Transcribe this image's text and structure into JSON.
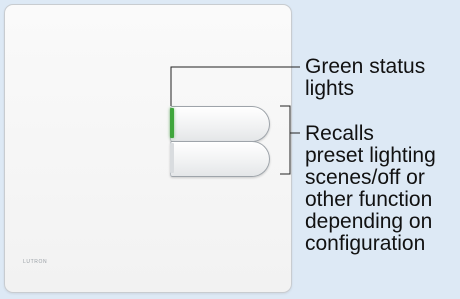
{
  "device": {
    "brand": "LUTRON"
  },
  "callouts": {
    "status_lights": "Green status\nlights",
    "buttons": "Recalls\npreset lighting\nscenes/off or\nother function\ndepending on\nconfiguration"
  },
  "colors": {
    "background": "#dde9f5",
    "status_light": "#3fa63c",
    "leader_line": "#222222"
  }
}
